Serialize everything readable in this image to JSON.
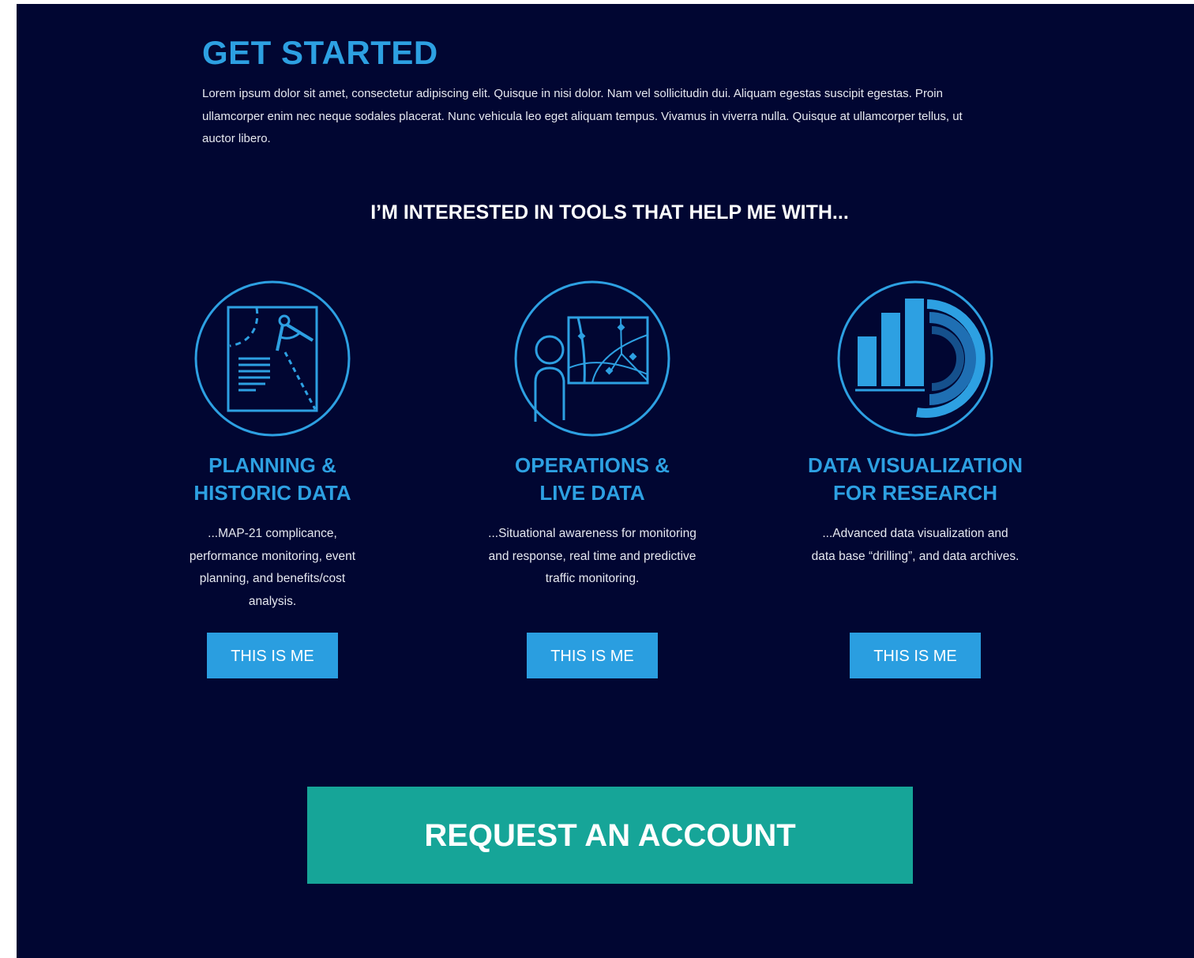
{
  "intro": {
    "title": "GET STARTED",
    "body": "Lorem ipsum dolor sit amet, consectetur adipiscing elit. Quisque in nisi dolor. Nam vel sollicitudin dui. Aliquam egestas suscipit egestas. Proin ullamcorper enim nec neque sodales placerat. Nunc vehicula leo eget aliquam tempus. Vivamus in viverra nulla. Quisque at ullamcorper tellus, ut auctor libero."
  },
  "interests": {
    "heading": "I’M INTERESTED IN TOOLS THAT HELP ME WITH...",
    "cards": [
      {
        "icon": "planning-document-compass-icon",
        "title_line1": "PLANNING &",
        "title_line2": "HISTORIC DATA",
        "description": "...MAP-21 complicance, performance monitoring, event planning, and benefits/cost analysis.",
        "button_label": "THIS IS ME"
      },
      {
        "icon": "operations-presenter-map-icon",
        "title_line1": "OPERATIONS &",
        "title_line2": "LIVE DATA",
        "description": "...Situational awareness for monitoring and response, real time and predictive traffic monitoring.",
        "button_label": "THIS IS ME"
      },
      {
        "icon": "data-visualization-bar-chart-icon",
        "title_line1": "DATA VISUALIZATION",
        "title_line2": "FOR RESEARCH",
        "description": "...Advanced data visualization and data base “drilling”, and data archives.",
        "button_label": "THIS IS ME"
      }
    ]
  },
  "cta": {
    "label": "REQUEST AN ACCOUNT"
  },
  "colors": {
    "background": "#010632",
    "accent_blue": "#2da0e2",
    "button_blue": "#2a9ee0",
    "cta_teal": "#16a598",
    "text_light": "#e6e8f0"
  }
}
